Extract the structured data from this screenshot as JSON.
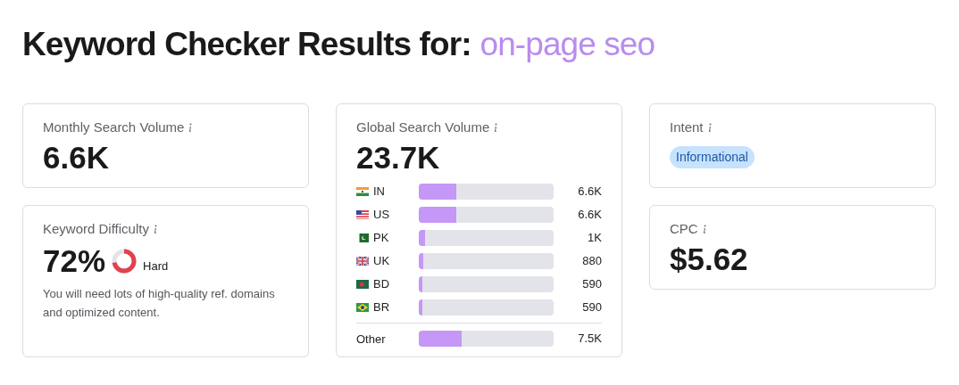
{
  "title": {
    "prefix": "Keyword Checker Results for:",
    "keyword": "on-page seo"
  },
  "monthly_volume": {
    "label": "Monthly Search Volume",
    "value": "6.6K"
  },
  "difficulty": {
    "label": "Keyword Difficulty",
    "value": "72%",
    "rating": "Hard",
    "note": "You will need lots of high-quality ref. domains and optimized content."
  },
  "global_volume": {
    "label": "Global Search Volume",
    "value": "23.7K",
    "rows": [
      {
        "kind": "india",
        "code": "IN",
        "level": 0.28,
        "value": "6.6K"
      },
      {
        "kind": "usa",
        "code": "US",
        "level": 0.28,
        "value": "6.6K"
      },
      {
        "kind": "pakistan",
        "code": "PK",
        "level": 0.045,
        "value": "1K"
      },
      {
        "kind": "uk",
        "code": "UK",
        "level": 0.035,
        "value": "880"
      },
      {
        "kind": "bangladesh",
        "code": "BD",
        "level": 0.025,
        "value": "590"
      },
      {
        "kind": "brazil",
        "code": "BR",
        "level": 0.025,
        "value": "590"
      },
      {
        "kind": "other",
        "code": "Other",
        "level": 0.315,
        "value": "7.5K"
      }
    ]
  },
  "intent": {
    "label": "Intent",
    "badge": "Informational"
  },
  "cpc": {
    "label": "CPC",
    "value": "$5.62"
  }
}
